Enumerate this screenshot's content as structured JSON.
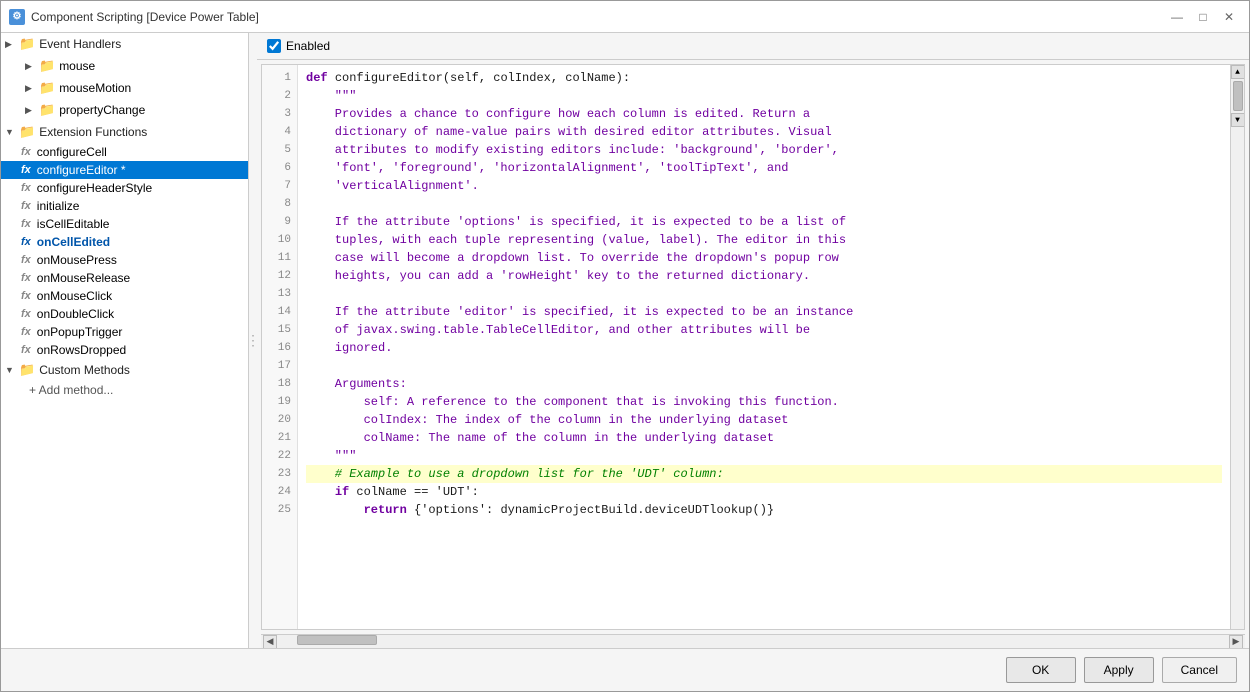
{
  "window": {
    "title": "Component Scripting [Device Power Table]",
    "icon": "⚙"
  },
  "titlebar": {
    "minimize_label": "—",
    "maximize_label": "□",
    "close_label": "✕"
  },
  "toolbar": {
    "enabled_label": "Enabled",
    "enabled_checked": true
  },
  "sidebar": {
    "event_handlers_label": "Event Handlers",
    "mouse_label": "mouse",
    "mouseMotion_label": "mouseMotion",
    "propertyChange_label": "propertyChange",
    "extension_functions_label": "Extension Functions",
    "items": [
      {
        "id": "configureCell",
        "label": "configureCell",
        "type": "func",
        "selected": false,
        "bold_blue": false
      },
      {
        "id": "configureEditor",
        "label": "configureEditor *",
        "type": "func",
        "selected": true,
        "bold_blue": false
      },
      {
        "id": "configureHeaderStyle",
        "label": "configureHeaderStyle",
        "type": "func",
        "selected": false,
        "bold_blue": false
      },
      {
        "id": "initialize",
        "label": "initialize",
        "type": "func",
        "selected": false,
        "bold_blue": false
      },
      {
        "id": "isCellEditable",
        "label": "isCellEditable",
        "type": "func",
        "selected": false,
        "bold_blue": false
      },
      {
        "id": "onCellEdited",
        "label": "onCellEdited",
        "type": "func",
        "selected": false,
        "bold_blue": true
      },
      {
        "id": "onMousePress",
        "label": "onMousePress",
        "type": "func",
        "selected": false,
        "bold_blue": false
      },
      {
        "id": "onMouseRelease",
        "label": "onMouseRelease",
        "type": "func",
        "selected": false,
        "bold_blue": false
      },
      {
        "id": "onMouseClick",
        "label": "onMouseClick",
        "type": "func",
        "selected": false,
        "bold_blue": false
      },
      {
        "id": "onDoubleClick",
        "label": "onDoubleClick",
        "type": "func",
        "selected": false,
        "bold_blue": false
      },
      {
        "id": "onPopupTrigger",
        "label": "onPopupTrigger",
        "type": "func",
        "selected": false,
        "bold_blue": false
      },
      {
        "id": "onRowsDropped",
        "label": "onRowsDropped",
        "type": "func",
        "selected": false,
        "bold_blue": false
      }
    ],
    "custom_methods_label": "Custom Methods",
    "add_method_label": "+ Add method..."
  },
  "code": {
    "lines": [
      {
        "num": 1,
        "content": "def configureEditor(self, colIndex, colName):",
        "highlighted": false,
        "parts": [
          {
            "t": "kw",
            "v": "def "
          },
          {
            "t": "fn",
            "v": "configureEditor"
          },
          {
            "t": "plain",
            "v": "("
          },
          {
            "t": "plain",
            "v": "self, colIndex, colName"
          },
          {
            "t": "plain",
            "v": ")"
          }
        ]
      },
      {
        "num": 2,
        "content": "    \"\"\"",
        "highlighted": false
      },
      {
        "num": 3,
        "content": "    Provides a chance to configure how each column is edited. Return a",
        "highlighted": false
      },
      {
        "num": 4,
        "content": "    dictionary of name-value pairs with desired editor attributes. Visual",
        "highlighted": false
      },
      {
        "num": 5,
        "content": "    attributes to modify existing editors include: 'background', 'border',",
        "highlighted": false
      },
      {
        "num": 6,
        "content": "    'font', 'foreground', 'horizontalAlignment', 'toolTipText', and",
        "highlighted": false
      },
      {
        "num": 7,
        "content": "    'verticalAlignment'.",
        "highlighted": false
      },
      {
        "num": 8,
        "content": "",
        "highlighted": false
      },
      {
        "num": 9,
        "content": "    If the attribute 'options' is specified, it is expected to be a list of",
        "highlighted": false
      },
      {
        "num": 10,
        "content": "    tuples, with each tuple representing (value, label). The editor in this",
        "highlighted": false
      },
      {
        "num": 11,
        "content": "    case will become a dropdown list. To override the dropdown's popup row",
        "highlighted": false
      },
      {
        "num": 12,
        "content": "    heights, you can add a 'rowHeight' key to the returned dictionary.",
        "highlighted": false
      },
      {
        "num": 13,
        "content": "",
        "highlighted": false
      },
      {
        "num": 14,
        "content": "    If the attribute 'editor' is specified, it is expected to be an instance",
        "highlighted": false
      },
      {
        "num": 15,
        "content": "    of javax.swing.table.TableCellEditor, and other attributes will be",
        "highlighted": false
      },
      {
        "num": 16,
        "content": "    ignored.",
        "highlighted": false
      },
      {
        "num": 17,
        "content": "",
        "highlighted": false
      },
      {
        "num": 18,
        "content": "    Arguments:",
        "highlighted": false
      },
      {
        "num": 19,
        "content": "        self: A reference to the component that is invoking this function.",
        "highlighted": false
      },
      {
        "num": 20,
        "content": "        colIndex: The index of the column in the underlying dataset",
        "highlighted": false
      },
      {
        "num": 21,
        "content": "        colName: The name of the column in the underlying dataset",
        "highlighted": false
      },
      {
        "num": 22,
        "content": "    \"\"\"",
        "highlighted": false
      },
      {
        "num": 23,
        "content": "    # Example to use a dropdown list for the 'UDT' column:",
        "highlighted": true
      },
      {
        "num": 24,
        "content": "    if colName == 'UDT':",
        "highlighted": false
      },
      {
        "num": 25,
        "content": "        return {'options': dynamicProjectBuild.deviceUDTlookup()}",
        "highlighted": false
      }
    ]
  },
  "buttons": {
    "ok_label": "OK",
    "apply_label": "Apply",
    "cancel_label": "Cancel"
  }
}
